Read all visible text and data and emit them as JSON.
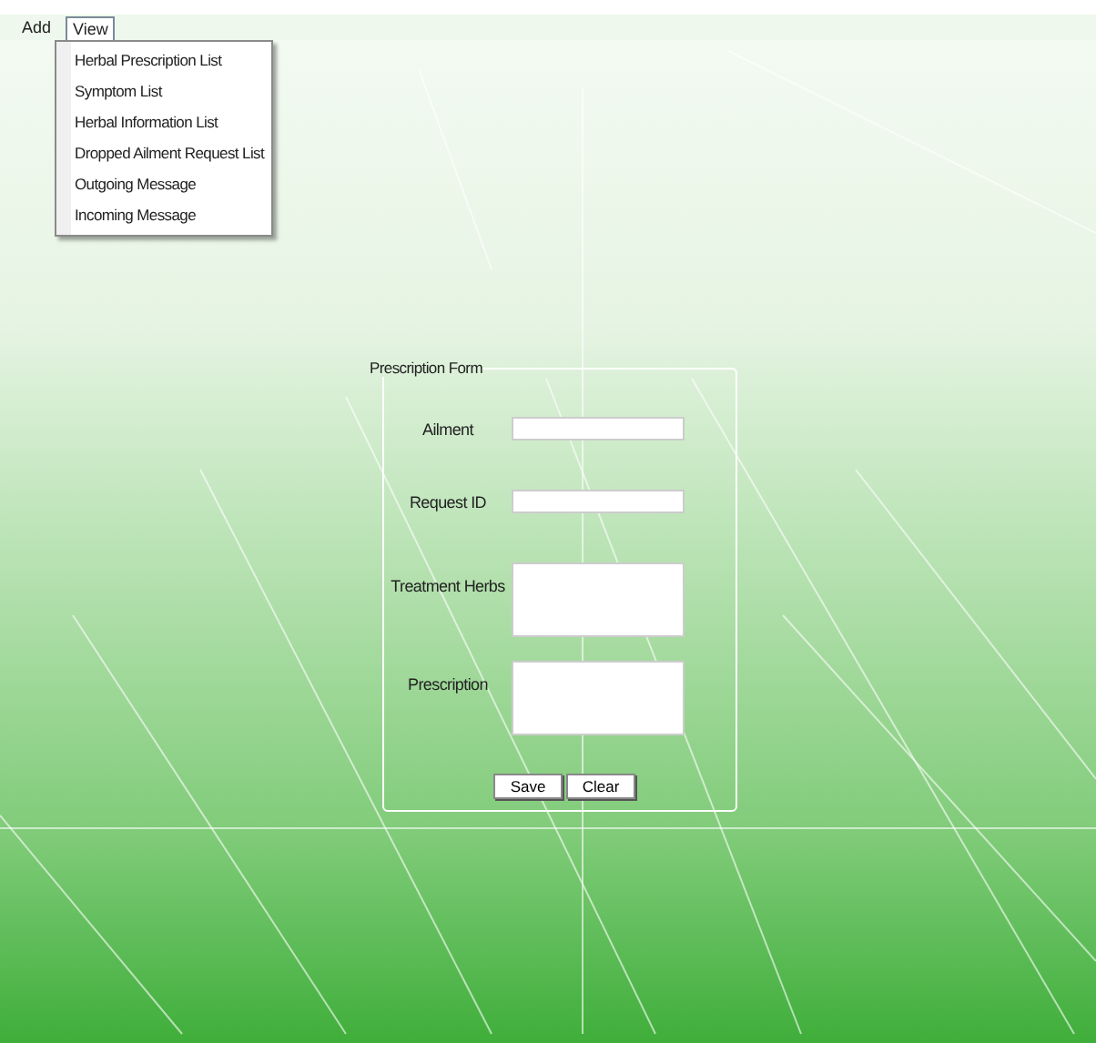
{
  "menu": [
    {
      "label": "Add",
      "selected": false
    },
    {
      "label": "View",
      "selected": true
    }
  ],
  "dropdown": {
    "items": [
      "Herbal Prescription List",
      "Symptom List",
      "Herbal Information List",
      "Dropped Ailment Request List",
      "Outgoing Message",
      "Incoming Message"
    ]
  },
  "form": {
    "title": "Prescription Form",
    "fields": [
      {
        "label": "Ailment",
        "kind": "line"
      },
      {
        "label": "Request ID",
        "kind": "line"
      },
      {
        "label": "Treatment Herbs",
        "kind": "area"
      },
      {
        "label": "Prescription",
        "kind": "area"
      }
    ],
    "buttons": [
      "Save",
      "Clear"
    ]
  }
}
